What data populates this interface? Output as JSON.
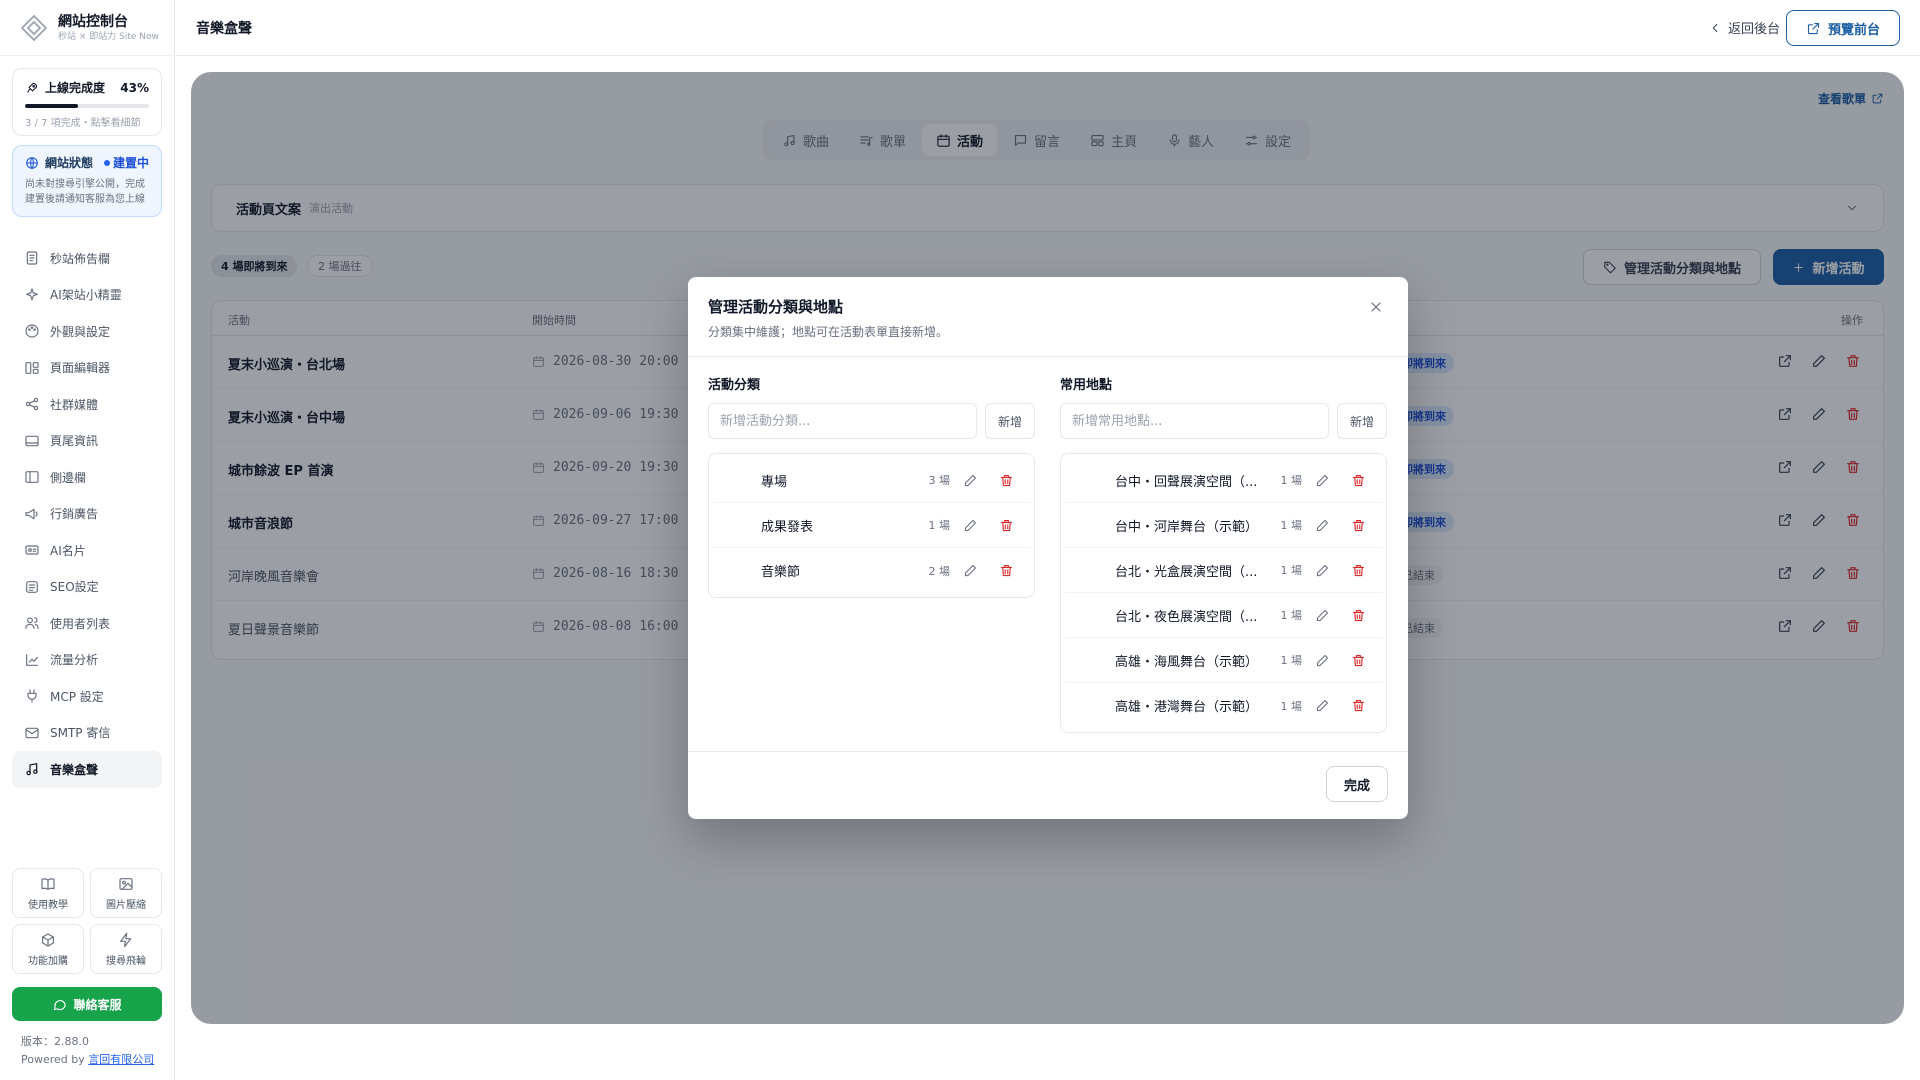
{
  "brand": {
    "title": "網站控制台",
    "subtitle": "秒站 × 即站力 Site Now"
  },
  "progress": {
    "label": "上線完成度",
    "percent": "43%",
    "fraction": 0.43,
    "note": "3 / 7 項完成・點擊看細節"
  },
  "site_status": {
    "label": "網站狀態",
    "badge": "建置中",
    "note": "尚未對搜尋引擎公開，完成建置後請通知客服為您上線"
  },
  "nav": [
    {
      "label": "秒站佈告欄",
      "icon": "bulletin-icon"
    },
    {
      "label": "AI架站小精靈",
      "icon": "sparkle-icon"
    },
    {
      "label": "外觀與設定",
      "icon": "palette-icon"
    },
    {
      "label": "頁面編輯器",
      "icon": "layout-icon"
    },
    {
      "label": "社群媒體",
      "icon": "share-icon"
    },
    {
      "label": "頁尾資訊",
      "icon": "footer-icon"
    },
    {
      "label": "側邊欄",
      "icon": "sidebar-icon"
    },
    {
      "label": "行銷廣告",
      "icon": "megaphone-icon"
    },
    {
      "label": "AI名片",
      "icon": "card-icon"
    },
    {
      "label": "SEO設定",
      "icon": "seo-icon"
    },
    {
      "label": "使用者列表",
      "icon": "users-icon"
    },
    {
      "label": "流量分析",
      "icon": "chart-icon"
    },
    {
      "label": "MCP 設定",
      "icon": "plug-icon"
    },
    {
      "label": "SMTP 寄信",
      "icon": "mail-icon"
    },
    {
      "label": "音樂盒聲",
      "icon": "music-icon",
      "active": true
    }
  ],
  "tiles": [
    {
      "label": "使用教學",
      "icon": "book-icon"
    },
    {
      "label": "圖片壓縮",
      "icon": "image-icon"
    },
    {
      "label": "功能加購",
      "icon": "package-icon"
    },
    {
      "label": "搜尋飛輪",
      "icon": "zap-icon"
    }
  ],
  "contact": "聯絡客服",
  "version": {
    "text": "版本：2.88.0",
    "powered": "Powered by",
    "company": "言回有限公司"
  },
  "topbar": {
    "title": "音樂盒聲",
    "back": "返回後台",
    "preview": "預覽前台"
  },
  "main": {
    "playlist_link": "查看歌單",
    "tabs": [
      {
        "label": "歌曲",
        "icon": "music-note-icon"
      },
      {
        "label": "歌單",
        "icon": "list-music-icon"
      },
      {
        "label": "活動",
        "icon": "calendar-icon",
        "active": true
      },
      {
        "label": "留言",
        "icon": "message-icon"
      },
      {
        "label": "主頁",
        "icon": "home-layout-icon"
      },
      {
        "label": "藝人",
        "icon": "mic-icon"
      },
      {
        "label": "設定",
        "icon": "settings-icon"
      }
    ],
    "copy_panel": {
      "title": "活動頁文案",
      "subtitle": "演出活動"
    },
    "upcoming_pill": "4 場即將到來",
    "past_pill": "2 場過往",
    "manage_button": "管理活動分類與地點",
    "add_button": "新增活動",
    "table": {
      "headers": {
        "event": "活動",
        "start": "開始時間",
        "actions": "操作"
      },
      "rows": [
        {
          "name": "夏末小巡演・台北場",
          "date": "2026-08-30",
          "time": "20:00",
          "status": "即將到來",
          "past": false
        },
        {
          "name": "夏末小巡演・台中場",
          "date": "2026-09-06",
          "time": "19:30",
          "status": "即將到來",
          "past": false
        },
        {
          "name": "城市餘波 EP 首演",
          "date": "2026-09-20",
          "time": "19:30",
          "status": "即將到來",
          "past": false
        },
        {
          "name": "城市音浪節",
          "date": "2026-09-27",
          "time": "17:00",
          "status": "即將到來",
          "past": false
        },
        {
          "name": "河岸晚風音樂會",
          "date": "2026-08-16",
          "time": "18:30",
          "status": "已結束",
          "past": true
        },
        {
          "name": "夏日聲景音樂節",
          "date": "2026-08-08",
          "time": "16:00",
          "status": "已結束",
          "past": true
        }
      ]
    }
  },
  "modal": {
    "title": "管理活動分類與地點",
    "subtitle": "分類集中維護；地點可在活動表單直接新增。",
    "categories": {
      "title": "活動分類",
      "placeholder": "新增活動分類...",
      "add": "新增",
      "items": [
        {
          "name": "專場",
          "count": "3 場"
        },
        {
          "name": "成果發表",
          "count": "1 場"
        },
        {
          "name": "音樂節",
          "count": "2 場"
        }
      ]
    },
    "venues": {
      "title": "常用地點",
      "placeholder": "新增常用地點...",
      "add": "新增",
      "items": [
        {
          "name": "台中・回聲展演空間（...",
          "count": "1 場"
        },
        {
          "name": "台中・河岸舞台（示範）",
          "count": "1 場"
        },
        {
          "name": "台北・光盒展演空間（...",
          "count": "1 場"
        },
        {
          "name": "台北・夜色展演空間（...",
          "count": "1 場"
        },
        {
          "name": "高雄・海風舞台（示範）",
          "count": "1 場"
        },
        {
          "name": "高雄・港灣舞台（示範）",
          "count": "1 場"
        }
      ]
    },
    "done": "完成"
  },
  "colors": {
    "primary": "#1d5fa5",
    "danger": "#dc2626",
    "success": "#16a34a",
    "status_blue": "#2563eb"
  }
}
